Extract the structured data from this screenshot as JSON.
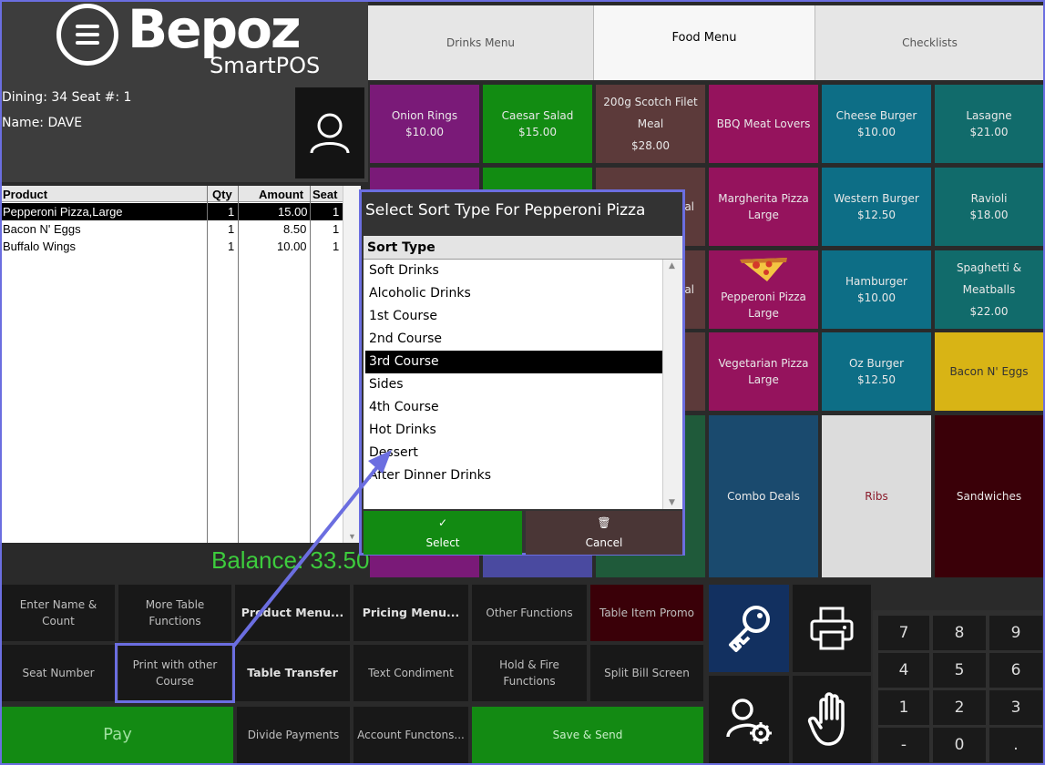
{
  "logo": {
    "brand": "Bepoz",
    "sub": "SmartPOS"
  },
  "customer": {
    "dining_line": "Dining: 34  Seat #: 1",
    "name_line": "Name: DAVE"
  },
  "order": {
    "headers": {
      "product": "Product",
      "qty": "Qty",
      "amount": "Amount",
      "seat": "Seat"
    },
    "rows": [
      {
        "product": "Pepperoni Pizza,Large",
        "qty": "1",
        "amount": "15.00",
        "seat": "1",
        "selected": true
      },
      {
        "product": "Bacon N' Eggs",
        "qty": "1",
        "amount": "8.50",
        "seat": "1"
      },
      {
        "product": "Buffalo Wings",
        "qty": "1",
        "amount": "10.00",
        "seat": "1"
      }
    ],
    "balance": "Balance: 33.50"
  },
  "tabs": {
    "drinks": "Drinks Menu",
    "food": "Food Menu",
    "checklists": "Checklists"
  },
  "menu": {
    "onion_rings": {
      "name": "Onion Rings",
      "price": "$10.00"
    },
    "caesar_salad": {
      "name": "Caesar Salad",
      "price": "$15.00"
    },
    "scotch_filet": {
      "name": "200g Scotch Filet",
      "name2": "Meal",
      "price": "$28.00"
    },
    "bbq_meat": {
      "name": "BBQ Meat Lovers"
    },
    "cheese_burger": {
      "name": "Cheese Burger",
      "price": "$10.00"
    },
    "lasagne": {
      "name": "Lasagne",
      "price": "$21.00"
    },
    "margherita": {
      "name": "Margherita Pizza",
      "size": "Large"
    },
    "western_burger": {
      "name": "Western Burger",
      "price": "$12.50"
    },
    "ravioli": {
      "name": "Ravioli",
      "price": "$18.00"
    },
    "pepperoni": {
      "name": "Pepperoni Pizza",
      "size": "Large"
    },
    "hamburger": {
      "name": "Hamburger",
      "price": "$10.00"
    },
    "spaghetti": {
      "name": "Spaghetti &",
      "name2": "Meatballs",
      "price": "$22.00"
    },
    "vegetarian": {
      "name": "Vegetarian Pizza",
      "size": "Large"
    },
    "oz_burger": {
      "name": "Oz Burger",
      "price": "$12.50"
    },
    "bacon_eggs": {
      "name": "Bacon N' Eggs"
    },
    "combo": {
      "name": "Combo Deals"
    },
    "ribs": {
      "name": "Ribs"
    },
    "sandwiches": {
      "name": "Sandwiches"
    },
    "partial_al_1": "al",
    "partial_al_2": "al"
  },
  "functions": {
    "enter_name": "Enter Name & Count",
    "more_table": "More Table Functions",
    "product_menu": "Product Menu...",
    "pricing_menu": "Pricing Menu...",
    "other_functions": "Other Functions",
    "table_promo": "Table Item Promo",
    "seat_number": "Seat Number",
    "print_other": "Print with other Course",
    "table_transfer": "Table Transfer",
    "text_condiment": "Text Condiment",
    "hold_fire": "Hold & Fire Functions",
    "split_bill": "Split Bill Screen",
    "pay": "Pay",
    "divide_payments": "Divide Payments",
    "account_functions": "Account Functons...",
    "save_send": "Save & Send"
  },
  "keypad": [
    "7",
    "8",
    "9",
    "4",
    "5",
    "6",
    "1",
    "2",
    "3",
    "-",
    "0",
    "."
  ],
  "dialog": {
    "title": "Select Sort Type For Pepperoni Pizza",
    "header": "Sort Type",
    "options": [
      "Soft Drinks",
      "Alcoholic Drinks",
      "1st Course",
      "2nd Course",
      "3rd Course",
      "Sides",
      "4th Course",
      "Hot Drinks",
      "Dessert",
      "After Dinner Drinks"
    ],
    "selected": "3rd Course",
    "select_label": "Select",
    "cancel_label": "Cancel"
  },
  "colors": {
    "purple": "#7a1a78",
    "green": "#128c12",
    "brown": "#5c3a3a",
    "magenta": "#95135d",
    "teal_blue": "#0d6e86",
    "teal": "#116b6b",
    "yellow": "#d8b415",
    "navy": "#1a4a6e",
    "light_gray": "#dcdcdc",
    "maroon": "#3a0008",
    "accent": "#6b6ee0",
    "balance": "#3dcc3d"
  }
}
